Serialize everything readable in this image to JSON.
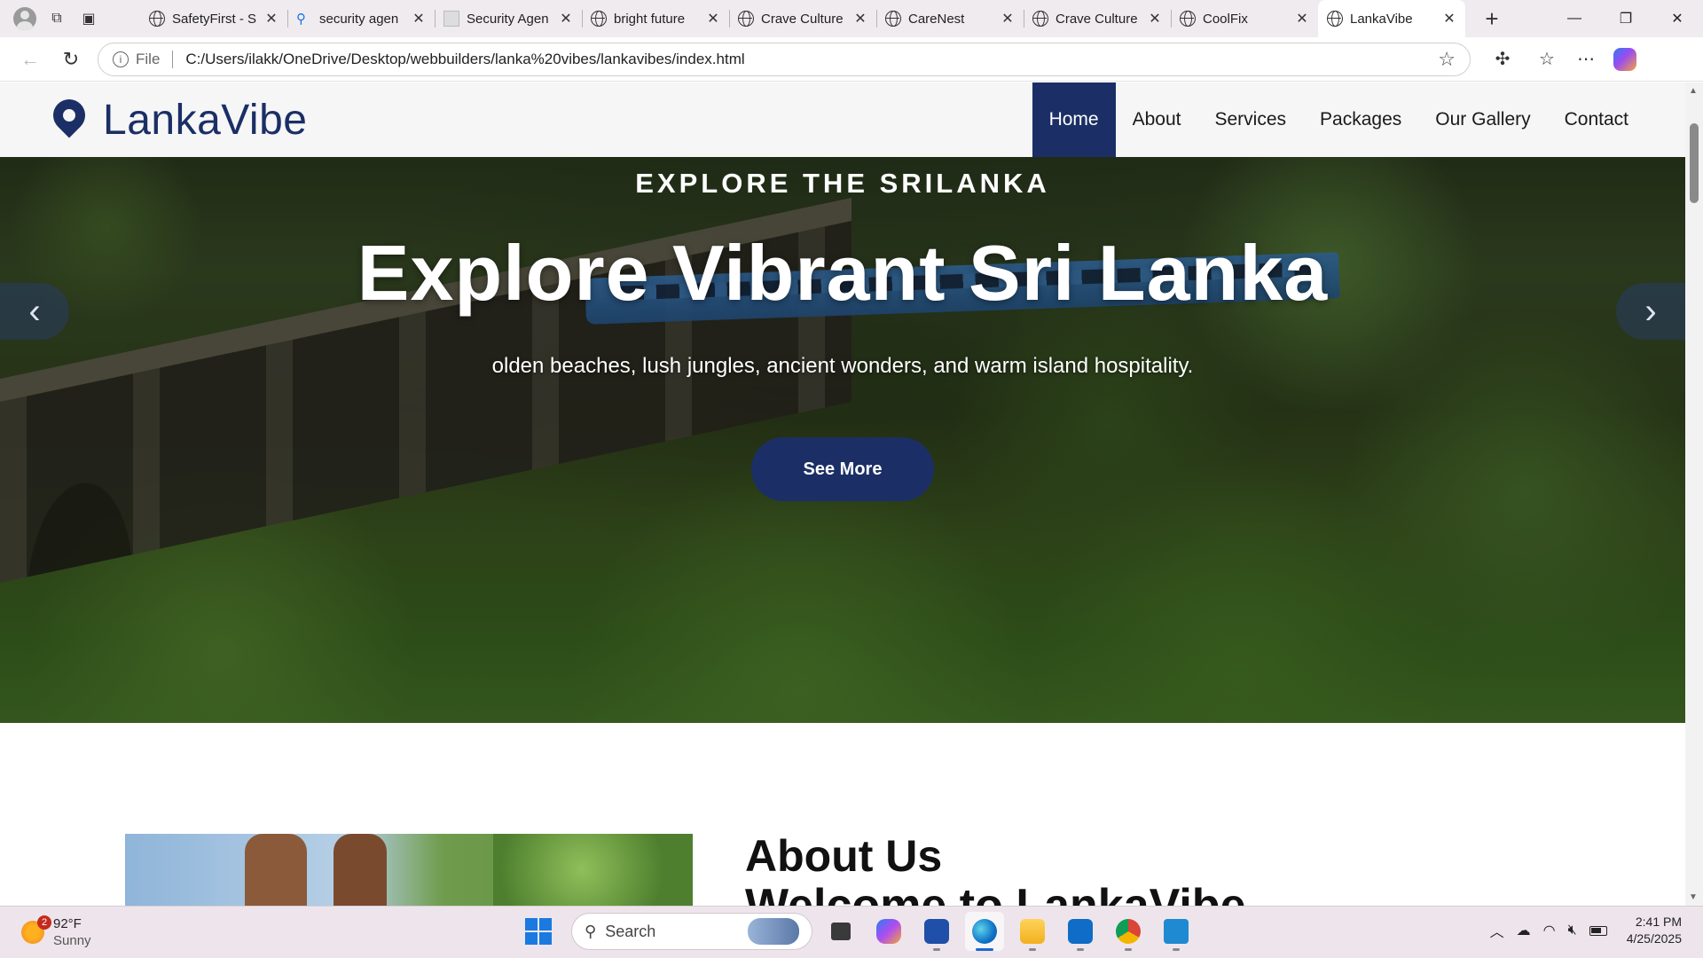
{
  "browser": {
    "tabs": [
      {
        "title": "SafetyFirst - S",
        "favicon": "globe-icon",
        "active": false
      },
      {
        "title": "security agen",
        "favicon": "search-icon",
        "active": false
      },
      {
        "title": "Security Agen",
        "favicon": "doc-icon",
        "active": false
      },
      {
        "title": "bright future",
        "favicon": "globe-icon",
        "active": false
      },
      {
        "title": "Crave Culture",
        "favicon": "globe-icon",
        "active": false
      },
      {
        "title": "CareNest",
        "favicon": "globe-icon",
        "active": false
      },
      {
        "title": "Crave Culture",
        "favicon": "globe-icon",
        "active": false
      },
      {
        "title": "CoolFix",
        "favicon": "globe-icon",
        "active": false
      },
      {
        "title": "LankaVibe",
        "favicon": "globe-icon",
        "active": true
      }
    ],
    "address": {
      "scheme_label": "File",
      "url": "C:/Users/ilakk/OneDrive/Desktop/webbuilders/lanka%20vibes/lankavibes/index.html"
    }
  },
  "site": {
    "brand": "LankaVibe",
    "nav": [
      {
        "label": "Home",
        "active": true
      },
      {
        "label": "About",
        "active": false
      },
      {
        "label": "Services",
        "active": false
      },
      {
        "label": "Packages",
        "active": false
      },
      {
        "label": "Our Gallery",
        "active": false
      },
      {
        "label": "Contact",
        "active": false
      }
    ],
    "hero": {
      "eyebrow": "EXPLORE THE SRILANKA",
      "title": "Explore Vibrant Sri Lanka",
      "subtitle": "olden beaches, lush jungles, ancient wonders, and warm island hospitality.",
      "cta": "See More",
      "prev_arrow": "‹",
      "next_arrow": "›"
    },
    "about": {
      "title": "About Us",
      "subtitle": "Welcome to LankaVibe"
    },
    "colors": {
      "brand": "#1b2f66",
      "header_bg": "#f6f6f6"
    }
  },
  "taskbar": {
    "weather": {
      "temp": "92°F",
      "condition": "Sunny",
      "badge": "2"
    },
    "search_placeholder": "Search",
    "apps": [
      "task-view-icon",
      "copilot-icon",
      "store-icon",
      "edge-icon",
      "file-explorer-icon",
      "outlook-icon",
      "chrome-icon",
      "vscode-icon"
    ],
    "time": "2:41 PM",
    "date": "4/25/2025"
  }
}
